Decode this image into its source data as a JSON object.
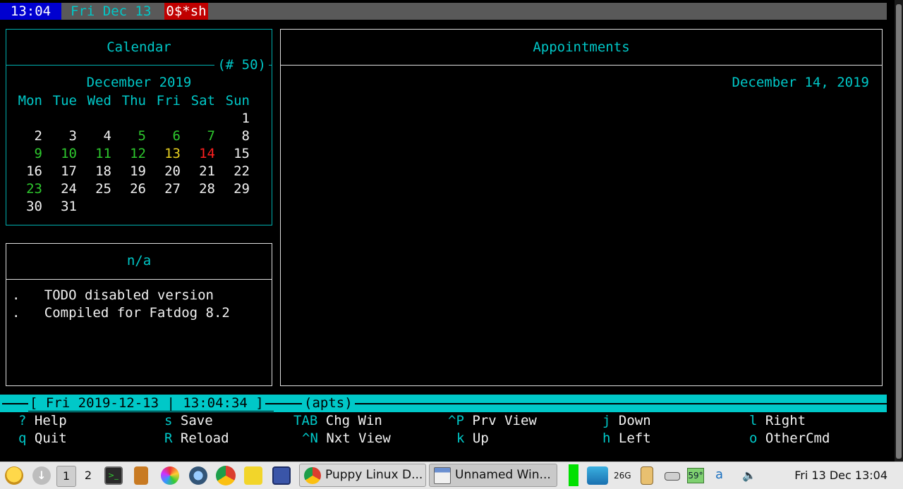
{
  "tmux": {
    "clock": "13:04",
    "date": "Fri Dec 13",
    "window": "0$*sh"
  },
  "calendar": {
    "title": "Calendar",
    "week_label": "(# 50)",
    "month": "December 2019",
    "weekdays": [
      "Mon",
      "Tue",
      "Wed",
      "Thu",
      "Fri",
      "Sat",
      "Sun"
    ],
    "weeks": [
      [
        null,
        null,
        null,
        null,
        null,
        null,
        {
          "d": "1",
          "c": "white"
        }
      ],
      [
        {
          "d": "2",
          "c": "white"
        },
        {
          "d": "3",
          "c": "white"
        },
        {
          "d": "4",
          "c": "white"
        },
        {
          "d": "5",
          "c": "green"
        },
        {
          "d": "6",
          "c": "green"
        },
        {
          "d": "7",
          "c": "green"
        },
        {
          "d": "8",
          "c": "white"
        }
      ],
      [
        {
          "d": "9",
          "c": "green"
        },
        {
          "d": "10",
          "c": "green"
        },
        {
          "d": "11",
          "c": "green"
        },
        {
          "d": "12",
          "c": "green"
        },
        {
          "d": "13",
          "c": "yellow"
        },
        {
          "d": "14",
          "c": "red"
        },
        {
          "d": "15",
          "c": "white"
        }
      ],
      [
        {
          "d": "16",
          "c": "white"
        },
        {
          "d": "17",
          "c": "white"
        },
        {
          "d": "18",
          "c": "white"
        },
        {
          "d": "19",
          "c": "white"
        },
        {
          "d": "20",
          "c": "white"
        },
        {
          "d": "21",
          "c": "white"
        },
        {
          "d": "22",
          "c": "white"
        }
      ],
      [
        {
          "d": "23",
          "c": "green"
        },
        {
          "d": "24",
          "c": "white"
        },
        {
          "d": "25",
          "c": "white"
        },
        {
          "d": "26",
          "c": "white"
        },
        {
          "d": "27",
          "c": "white"
        },
        {
          "d": "28",
          "c": "white"
        },
        {
          "d": "29",
          "c": "white"
        }
      ],
      [
        {
          "d": "30",
          "c": "white"
        },
        {
          "d": "31",
          "c": "white"
        },
        null,
        null,
        null,
        null,
        null
      ]
    ]
  },
  "todo": {
    "title": "n/a",
    "lines": [
      ".   TODO disabled version",
      ".   Compiled for Fatdog 8.2"
    ]
  },
  "appointments": {
    "title": "Appointments",
    "date": "December 14, 2019"
  },
  "statusbar": {
    "datetime": "[ Fri 2019-12-13 | 13:04:34 ]",
    "mode": "(apts)"
  },
  "keys": [
    {
      "key": "?",
      "label": "Help"
    },
    {
      "key": "s",
      "label": "Save"
    },
    {
      "key": "TAB",
      "label": "Chg Win"
    },
    {
      "key": "^P",
      "label": "Prv View"
    },
    {
      "key": "j",
      "label": "Down"
    },
    {
      "key": "l",
      "label": "Right"
    },
    {
      "key": "q",
      "label": "Quit"
    },
    {
      "key": "R",
      "label": "Reload"
    },
    {
      "key": "^N",
      "label": "Nxt View"
    },
    {
      "key": "k",
      "label": "Up"
    },
    {
      "key": "h",
      "label": "Left"
    },
    {
      "key": "o",
      "label": "OtherCmd"
    }
  ],
  "taskbar": {
    "workspaces": [
      "1",
      "2"
    ],
    "tasks": [
      {
        "label": "Puppy Linux D...",
        "icon": "chrome-icon"
      },
      {
        "label": "Unnamed Win...",
        "icon": "window-icon"
      }
    ],
    "tray": {
      "disk": "26G",
      "temp": "59°",
      "kbd": "a"
    },
    "clock": "Fri 13 Dec 13:04",
    "colors": {
      "accent_green": "#00e000",
      "cyan": "#00c8c8"
    }
  }
}
